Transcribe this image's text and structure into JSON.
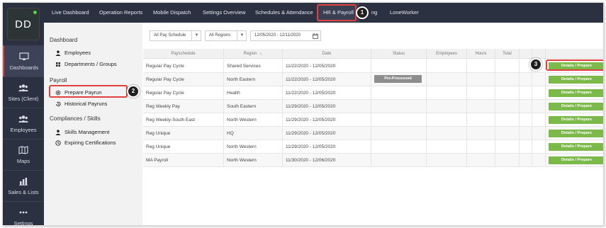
{
  "user": {
    "initials": "DD"
  },
  "sidebar": {
    "items": [
      {
        "label": "Dashboards",
        "icon": "monitor-icon"
      },
      {
        "label": "Sites (Client)",
        "icon": "people-group-icon"
      },
      {
        "label": "Employees",
        "icon": "people-group-icon"
      },
      {
        "label": "Maps",
        "icon": "map-icon"
      },
      {
        "label": "Sales & Lists",
        "icon": "bar-chart-icon"
      },
      {
        "label": "Settings",
        "icon": "ellipsis-icon"
      }
    ]
  },
  "topnav": {
    "items": [
      {
        "label": "Live Dashboard"
      },
      {
        "label": "Operation Reports"
      },
      {
        "label": "Mobile Dispatch"
      },
      {
        "label": "Settings Overview"
      },
      {
        "label": "Schedules & Attendance"
      },
      {
        "label": "HR & Payroll"
      },
      {
        "label": "ng"
      },
      {
        "label": "LoneWorker"
      }
    ],
    "active": "HR & Payroll"
  },
  "callouts": {
    "one": "1",
    "two": "2",
    "three": "3"
  },
  "submenu": {
    "dashboard_heading": "Dashboard",
    "employees": "Employees",
    "departments": "Departments / Groups",
    "payroll_heading": "Payroll",
    "prepare_payrun": "Prepare Payrun",
    "historical_payruns": "Historical Payruns",
    "compliances_heading": "Compliances / Skills",
    "skills_management": "Skills Management",
    "expiring_certifications": "Expiring Certifications"
  },
  "filters": {
    "pay_schedule": "All Pay Schedule",
    "regions": "All Regions",
    "date_range": "12/05/2020 - 12/11/2020"
  },
  "table": {
    "headers": [
      "Payschedule",
      "Region",
      "Date",
      "Status",
      "Employees",
      "Hours",
      "Total"
    ],
    "action_label": "Details / Prepare",
    "rows": [
      {
        "payschedule": "Regular Pay Cycle",
        "region": "Shared Services",
        "date": "11/22/2020 - 12/05/2020",
        "status": ""
      },
      {
        "payschedule": "Regular Pay Cycle",
        "region": "North Eastern",
        "date": "11/22/2020 - 12/05/2020",
        "status": "Pre-Processed"
      },
      {
        "payschedule": "Regular Pay Cycle",
        "region": "Health",
        "date": "11/22/2020 - 12/05/2020",
        "status": ""
      },
      {
        "payschedule": "Reg Weekly Pay",
        "region": "South Eastern",
        "date": "11/29/2020 - 12/05/2020",
        "status": ""
      },
      {
        "payschedule": "Reg Weekly-South East",
        "region": "North Western",
        "date": "11/29/2020 - 12/05/2020",
        "status": ""
      },
      {
        "payschedule": "Reg Unique",
        "region": "HQ",
        "date": "11/29/2020 - 12/05/2020",
        "status": ""
      },
      {
        "payschedule": "Reg Unique",
        "region": "North Western",
        "date": "11/29/2020 - 12/05/2020",
        "status": ""
      },
      {
        "payschedule": "MA Payroll",
        "region": "North Western",
        "date": "11/30/2020 - 12/06/2020",
        "status": ""
      }
    ]
  },
  "colors": {
    "nav_bg": "#2c3142",
    "highlight": "#e0403f",
    "action_green": "#7cb84a",
    "status_gray": "#8d8d8d"
  }
}
